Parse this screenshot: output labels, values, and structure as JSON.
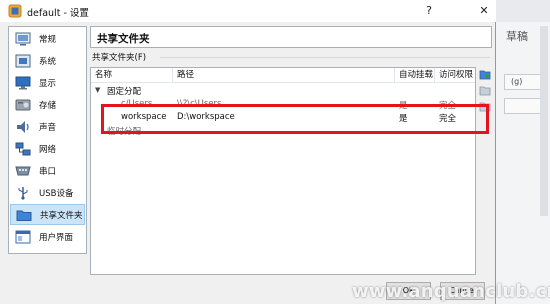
{
  "window": {
    "title": "default - 设置",
    "help_label": "?",
    "close_label": "✕"
  },
  "background": {
    "right_text": "草稿",
    "status_text": "(g)"
  },
  "sidebar": {
    "items": [
      {
        "label": "常规",
        "icon": "general-icon"
      },
      {
        "label": "系统",
        "icon": "system-icon"
      },
      {
        "label": "显示",
        "icon": "display-icon"
      },
      {
        "label": "存储",
        "icon": "storage-icon"
      },
      {
        "label": "声音",
        "icon": "audio-icon"
      },
      {
        "label": "网络",
        "icon": "network-icon"
      },
      {
        "label": "串口",
        "icon": "serial-port-icon"
      },
      {
        "label": "USB设备",
        "icon": "usb-icon"
      },
      {
        "label": "共享文件夹",
        "icon": "shared-folder-icon",
        "selected": true
      },
      {
        "label": "用户界面",
        "icon": "user-interface-icon"
      }
    ]
  },
  "main": {
    "page_title": "共享文件夹",
    "group_label": "共享文件夹(F)",
    "columns": {
      "name": "名称",
      "path": "路径",
      "auto_mount": "自动挂载",
      "access": "访问权限"
    },
    "groups": {
      "fixed": "固定分配",
      "temporary": "临时分配"
    },
    "rows": [
      {
        "name": "c/Users",
        "path": "\\\\?\\c\\Users",
        "auto_mount": "是",
        "access": "完全"
      },
      {
        "name": "workspace",
        "path": "D:\\workspace",
        "auto_mount": "是",
        "access": "完全"
      }
    ]
  },
  "buttons": {
    "ok": "OK",
    "cancel": "Cancel"
  },
  "watermark": "www.anquanclub.cn",
  "colors": {
    "highlight": "#e3141d",
    "selection": "#cce4f7"
  }
}
